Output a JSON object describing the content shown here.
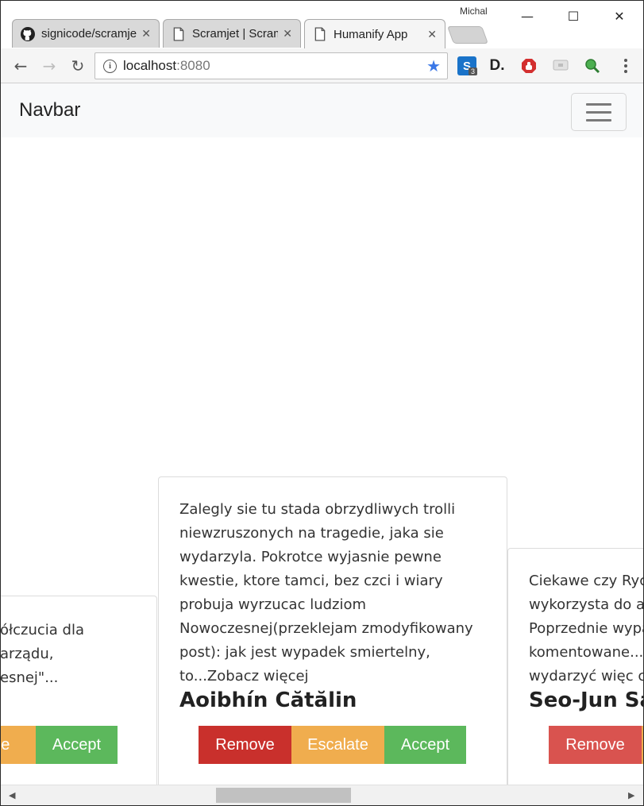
{
  "window": {
    "profile_name": "Michal",
    "min_glyph": "—",
    "max_glyph": "☐",
    "close_glyph": "✕"
  },
  "tabs": [
    {
      "label": "signicode/scramjet",
      "icon": "github-icon",
      "active": false
    },
    {
      "label": "Scramjet | Scramjet",
      "icon": "page-icon",
      "active": false
    },
    {
      "label": "Humanify App",
      "icon": "page-icon",
      "active": true
    }
  ],
  "tab_close_glyph": "✕",
  "toolbar": {
    "back_glyph": "←",
    "forward_glyph": "→",
    "reload_glyph": "↻",
    "info_glyph": "i",
    "url_host": "localhost",
    "url_port": ":8080",
    "star_glyph": "★",
    "extensions": [
      {
        "name": "s-extension-icon",
        "label": "S",
        "badge": "3"
      },
      {
        "name": "d-extension-icon",
        "label": "D."
      },
      {
        "name": "adblock-icon"
      },
      {
        "name": "cast-extension-icon"
      },
      {
        "name": "green-extension-icon"
      }
    ]
  },
  "navbar": {
    "brand": "Navbar"
  },
  "cards": {
    "left": {
      "text": "ółczucia dla\narządu,\nesnej\"...",
      "buttons": {
        "escalate": "ate",
        "accept": "Accept"
      }
    },
    "center": {
      "text": "Zalegly sie tu stada obrzydliwych trolli niewzruszonych na tragedie, jaka sie wydarzyla. Pokrotce wyjasnie pewne kwestie, ktore tamci, bez czci i wiary probuja wyrzucac ludziom Nowoczesnej(przeklejam zmodyfikowany post): jak jest wypadek smiertelny, to...Zobacz więcej",
      "author": "Aoibhín Cătălin",
      "buttons": {
        "remove": "Remove",
        "escalate": "Escalate",
        "accept": "Accept"
      }
    },
    "right": {
      "text": "Ciekawe czy Ryc\nwykorzysta do al\nPoprzednie wypa\nkomentowane...N\nwydarzyć więc cz",
      "author": "Seo-Jun Sa",
      "buttons": {
        "remove": "Remove"
      }
    }
  },
  "scrollbar": {
    "left_glyph": "◀",
    "right_glyph": "▶"
  },
  "colors": {
    "remove": "#d9534f",
    "remove_active": "#c9302c",
    "escalate": "#f0ad4e",
    "accept": "#5cb85c",
    "navbar_bg": "#f8f9fa"
  }
}
